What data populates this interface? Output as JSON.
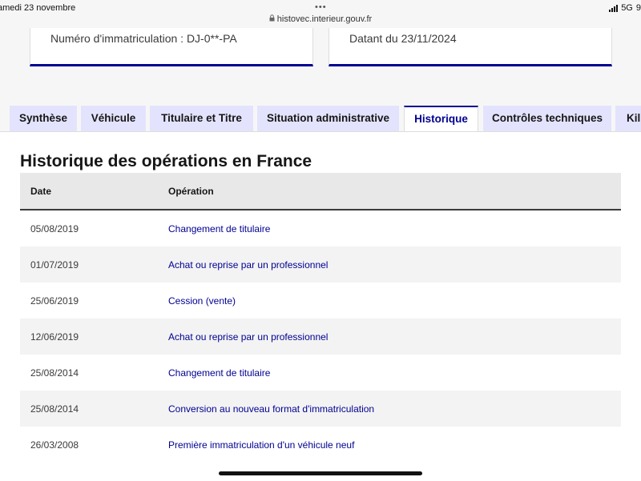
{
  "status_bar": {
    "date": "amedi 23 novembre",
    "network": "5G",
    "extra": "9",
    "dots": "•••"
  },
  "url_bar": {
    "url": "histovec.interieur.gouv.fr"
  },
  "cards": {
    "left_text": "Numéro d'immatriculation : DJ-0**-PA",
    "right_text": "Datant du 23/11/2024"
  },
  "tabs": [
    {
      "label": "Synthèse",
      "active": false
    },
    {
      "label": "Véhicule",
      "active": false
    },
    {
      "label": "Titulaire et Titre",
      "active": false
    },
    {
      "label": "Situation administrative",
      "active": false
    },
    {
      "label": "Historique",
      "active": true
    },
    {
      "label": "Contrôles techniques",
      "active": false
    },
    {
      "label": "Kil",
      "active": false
    }
  ],
  "history": {
    "title": "Historique des opérations en France",
    "columns": [
      "Date",
      "Opération"
    ],
    "rows": [
      {
        "date": "05/08/2019",
        "operation": "Changement de titulaire"
      },
      {
        "date": "01/07/2019",
        "operation": "Achat ou reprise par un professionnel"
      },
      {
        "date": "25/06/2019",
        "operation": "Cession (vente)"
      },
      {
        "date": "12/06/2019",
        "operation": "Achat ou reprise par un professionnel"
      },
      {
        "date": "25/08/2014",
        "operation": "Changement de titulaire"
      },
      {
        "date": "25/08/2014",
        "operation": "Conversion au nouveau format d'immatriculation"
      },
      {
        "date": "26/03/2008",
        "operation": "Première immatriculation d'un véhicule neuf"
      }
    ]
  },
  "colors": {
    "accent": "#000091",
    "tab_inactive_bg": "#e3e3fd",
    "row_alt_bg": "#f3f3f3"
  }
}
